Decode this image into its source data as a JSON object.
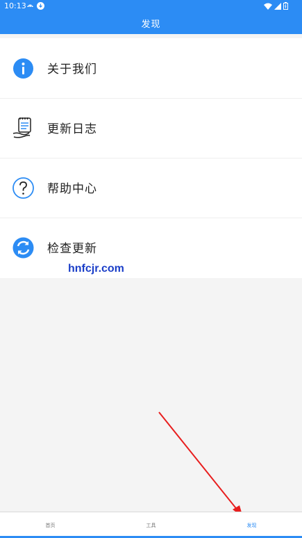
{
  "status_bar": {
    "time": "10:13",
    "icons": [
      "app-notification-icon",
      "download-notification-icon",
      "wifi-icon",
      "signal-icon",
      "battery-icon"
    ]
  },
  "header": {
    "title": "发现"
  },
  "menu": {
    "items": [
      {
        "label": "关于我们",
        "icon": "info-icon"
      },
      {
        "label": "更新日志",
        "icon": "changelog-icon"
      },
      {
        "label": "帮助中心",
        "icon": "help-icon"
      },
      {
        "label": "检查更新",
        "icon": "refresh-icon"
      }
    ]
  },
  "watermark": "hnfcjr.com",
  "bottom_nav": {
    "tabs": [
      {
        "label": "首页",
        "active": false
      },
      {
        "label": "工具",
        "active": false
      },
      {
        "label": "发现",
        "active": true
      }
    ]
  },
  "colors": {
    "primary": "#2c8cf4",
    "annotation_arrow": "#e81e1e"
  }
}
